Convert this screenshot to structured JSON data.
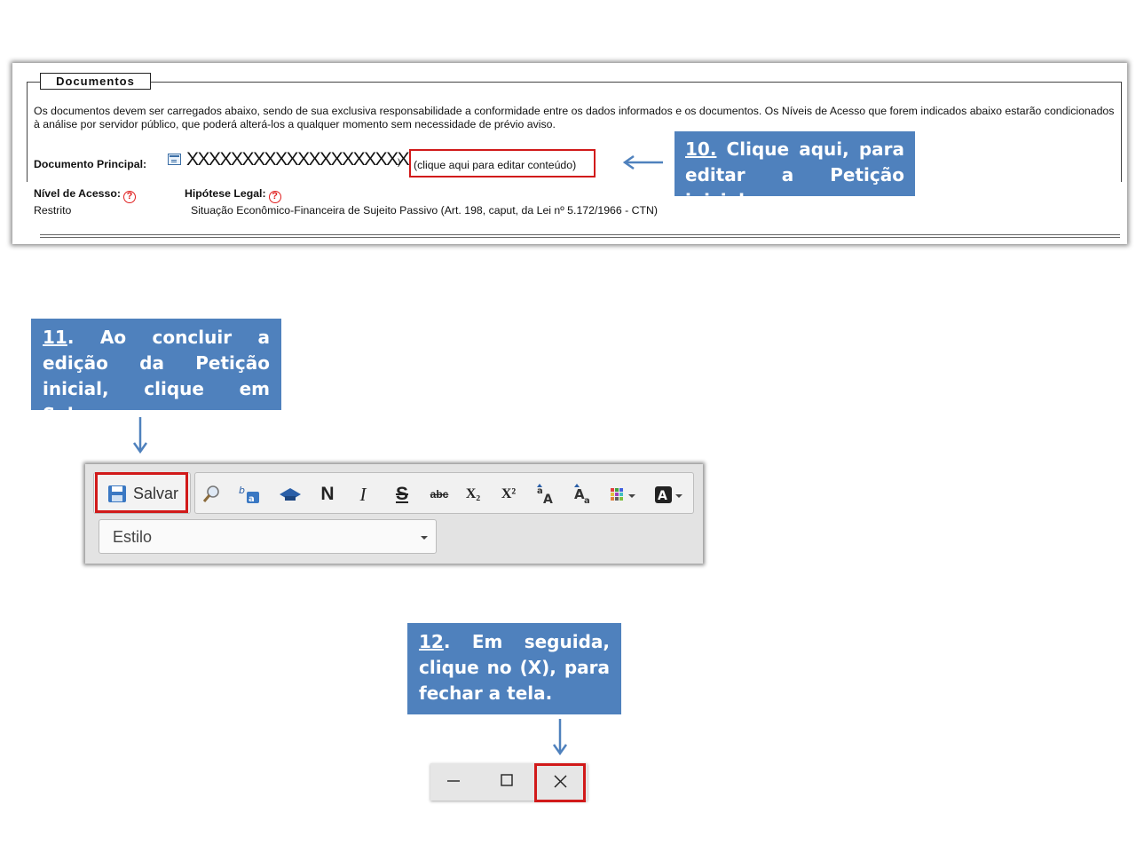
{
  "documentos": {
    "legend": "Documentos",
    "intro": "Os documentos devem ser carregados abaixo, sendo de sua exclusiva responsabilidade a conformidade entre os dados informados e os documentos. Os Níveis de Acesso que forem indicados abaixo estarão condicionados à análise por servidor público, que poderá alterá-los a qualquer momento sem necessidade de prévio aviso.",
    "principal_label": "Documento Principal:",
    "principal_name": "XXXXXXXXXXXXXXXXXXXX",
    "separator": ")",
    "edit_link": "(clique aqui para editar conteúdo)",
    "nivel_label": "Nível de Acesso:",
    "nivel_value": "Restrito",
    "hipotese_label": "Hipótese Legal:",
    "hipotese_value": "Situação Econômico-Financeira de Sujeito Passivo (Art. 198, caput, da Lei nº 5.172/1966 - CTN)",
    "help_symbol": "?"
  },
  "callouts": {
    "step10": {
      "num": "10.",
      "text": " Clique aqui, para editar a Petição inicial."
    },
    "step11": {
      "num": "11",
      "text": ". Ao concluir a edição da Petição inicial, clique em Salvar."
    },
    "step12": {
      "num": "12",
      "text": ". Em seguida, clique no (X), para fechar a tela."
    }
  },
  "toolbar": {
    "save_label": "Salvar",
    "bold": "N",
    "italic": "I",
    "strike": "S",
    "abc": "abc",
    "subscript": "X₂",
    "superscript": "X²",
    "style_label": "Estilo",
    "icons": [
      "save-icon",
      "find-icon",
      "replace-icon",
      "cap-icon",
      "bold-icon",
      "italic-icon",
      "strikethrough-icon",
      "abc-icon",
      "subscript-icon",
      "superscript-icon",
      "font-size-up-icon",
      "font-size-down-icon",
      "color-grid-icon",
      "text-color-icon"
    ]
  },
  "window": {
    "minimize": "−",
    "maximize": "☐",
    "close": "✕"
  },
  "colors": {
    "callout": "#4f81bd",
    "highlight": "#d11a1a"
  }
}
